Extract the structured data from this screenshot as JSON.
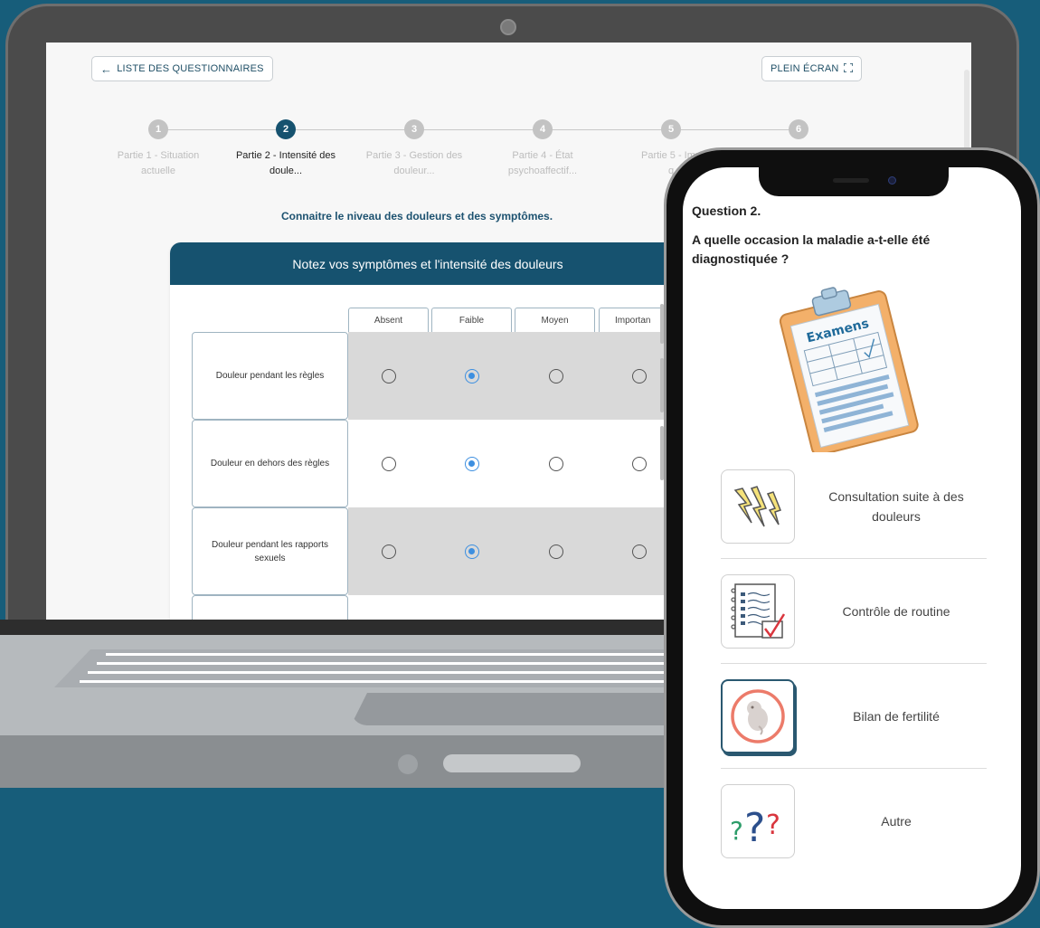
{
  "laptop": {
    "back_button": "LISTE DES QUESTIONNAIRES",
    "fullscreen_button": "PLEIN ÉCRAN",
    "steps": [
      {
        "number": "1",
        "label_line1": "Partie 1 - Situation",
        "label_line2": "actuelle"
      },
      {
        "number": "2",
        "label_line1": "Partie 2 - Intensité des",
        "label_line2": "doule..."
      },
      {
        "number": "3",
        "label_line1": "Partie 3 - Gestion des",
        "label_line2": "douleur..."
      },
      {
        "number": "4",
        "label_line1": "Partie 4 - État",
        "label_line2": "psychoaffectif..."
      },
      {
        "number": "5",
        "label_line1": "Partie 5 - Imp",
        "label_line2": "q"
      },
      {
        "number": "6",
        "label_line1": "",
        "label_line2": ""
      }
    ],
    "active_step": 2,
    "subtitle": "Connaitre le niveau des douleurs et des symptômes.",
    "card_title": "Notez vos symptômes et l'intensité des douleurs",
    "columns": [
      "Absent",
      "Faible",
      "Moyen",
      "Importan"
    ],
    "rows": [
      {
        "label": "Douleur pendant les règles",
        "selected": 1
      },
      {
        "label": "Douleur en dehors des règles",
        "selected": 1
      },
      {
        "label": "Douleur pendant les rapports sexuels",
        "selected": 1
      }
    ]
  },
  "phone": {
    "question_number": "Question 2.",
    "question_text": "A quelle occasion la maladie a-t-elle été diagnostiquée ?",
    "illustration_text": "Examens",
    "options": [
      {
        "label": "Consultation suite à des douleurs",
        "icon": "lightning-icon",
        "selected": false
      },
      {
        "label": "Contrôle de routine",
        "icon": "checklist-icon",
        "selected": false
      },
      {
        "label": "Bilan de fertilité",
        "icon": "embryo-icon",
        "selected": true
      },
      {
        "label": "Autre",
        "icon": "question-marks-icon",
        "selected": false
      }
    ]
  },
  "colors": {
    "background": "#175d7a",
    "primary": "#16526f",
    "radio_checked": "#3d8fe0",
    "clipboard": "#f3b06a"
  }
}
